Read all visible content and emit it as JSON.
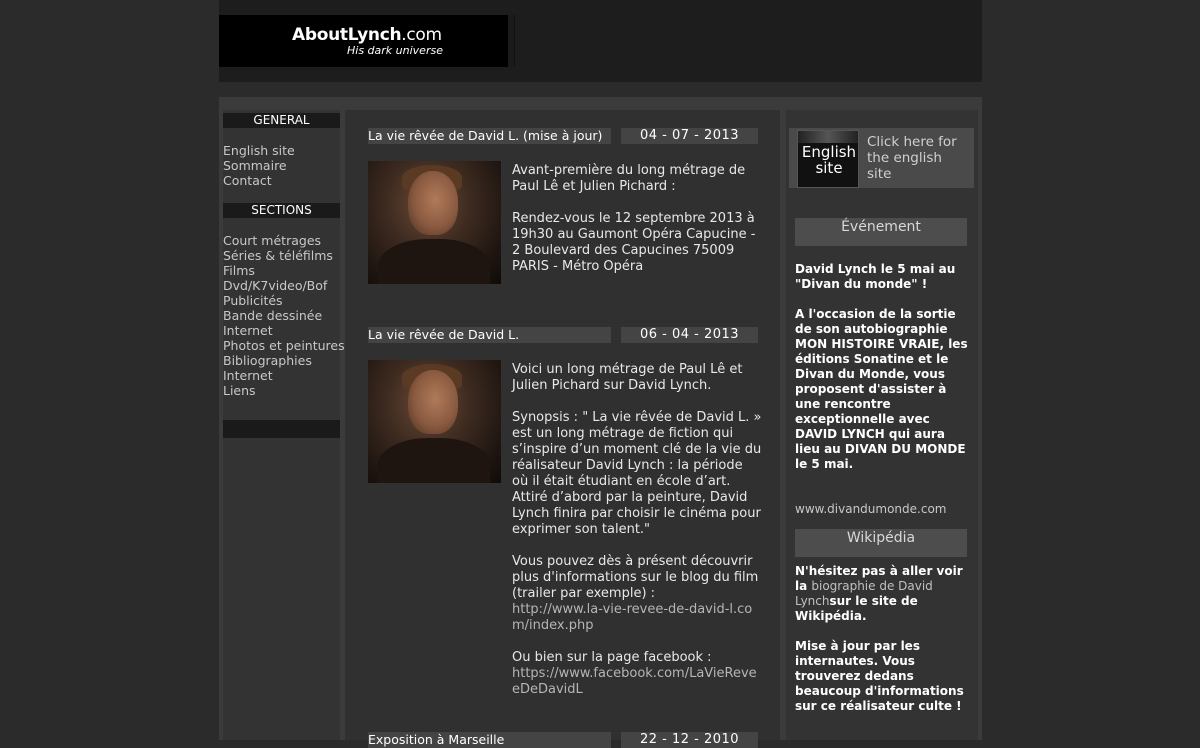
{
  "header": {
    "logo_title_bold": "AboutLynch",
    "logo_title_domain": ".com",
    "logo_subtitle": "His dark universe"
  },
  "nav": {
    "general_heading": "GENERAL",
    "general_items": [
      "English site",
      "Sommaire",
      "Contact"
    ],
    "sections_heading": "SECTIONS",
    "section_items": [
      "Court métrages",
      "Séries & téléfilms",
      "Films",
      "Dvd/K7video/Bof",
      "Publicités",
      "Bande dessinée",
      "Internet",
      "Photos et peintures",
      "Bibliographies",
      "Internet",
      "Liens"
    ]
  },
  "articles": [
    {
      "title": "La vie rêvée de David L. (mise à jour)",
      "date": "04 - 07 - 2013",
      "paragraphs": [
        "Avant-première du long métrage de Paul Lê et Julien Pichard :",
        "Rendez-vous le 12 septembre 2013 à 19h30 au Gaumont Opéra Capucine - 2 Boulevard des Capucines 75009 PARIS - Métro Opéra"
      ]
    },
    {
      "title": "La vie rêvée de David L.",
      "date": "06 - 04 - 2013",
      "paragraphs": [
        "Voici un long métrage de Paul Lê et Julien Pichard sur David Lynch.",
        "Synopsis : \" La vie rêvée de David L. » est un long métrage de fiction qui s’inspire d’un moment clé de la vie du réalisateur David Lynch : la période où il était étudiant en école d’art. Attiré d’abord par la peinture, David Lynch finira par choisir le cinéma pour exprimer son talent.\"",
        "Vous pouvez dès à présent découvrir plus d'informations sur le blog du film (trailer par exemple) :"
      ],
      "blog_link": "http://www.la-vie-revee-de-david-l.com/index.php",
      "facebook_intro": "Ou bien sur la page facebook :",
      "facebook_link": "https://www.facebook.com/LaVieReveeDeDavidL"
    },
    {
      "title": "Exposition à Marseille",
      "date": "22 - 12 - 2010"
    }
  ],
  "right": {
    "english_thumb_text": "English site",
    "english_link_text": "Click here for the english site",
    "event_heading": "Événement",
    "event_p1": "David Lynch le 5 mai au \"Divan du monde\" !",
    "event_p2": "A l'occasion de la sortie de son autobiographie MON HISTOIRE VRAIE, les éditions Sonatine et le Divan du Monde, vous proposent d'assister à une rencontre exceptionnelle avec DAVID LYNCH qui aura lieu au DIVAN DU MONDE le 5 mai.",
    "event_link": "www.divandumonde.com",
    "wiki_heading": "Wikipédia",
    "wiki_pre": "N'hésitez pas à aller voir la ",
    "wiki_link": "biographie de David Lynch",
    "wiki_post": "sur le site de Wikipédia.",
    "wiki_p2": "Mise à jour par les internautes. Vous trouverez dedans beaucoup d'informations sur ce réalisateur culte !"
  }
}
